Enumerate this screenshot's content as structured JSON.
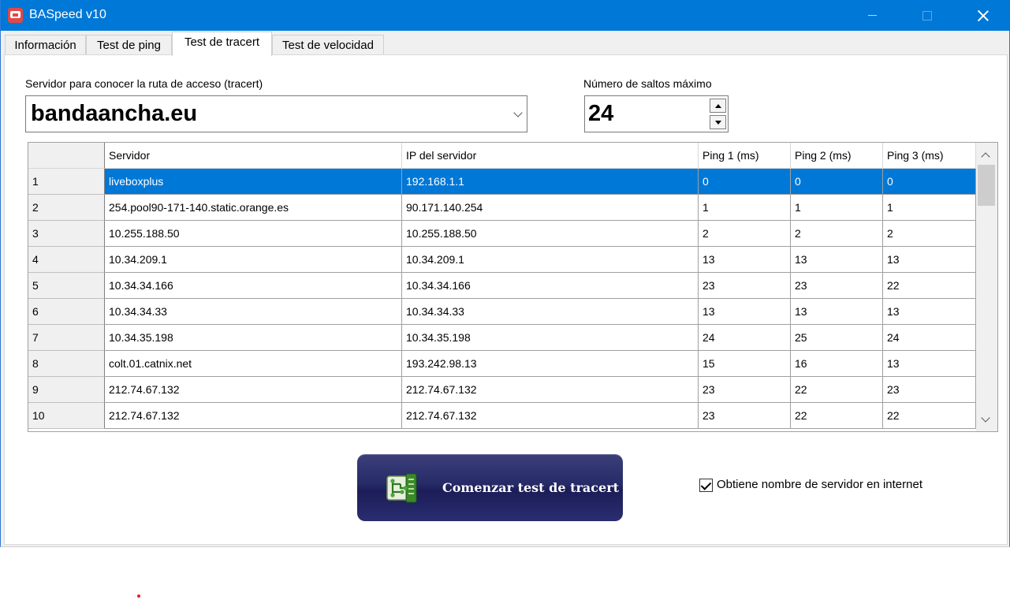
{
  "window": {
    "title": "BASpeed v10"
  },
  "tabs": [
    {
      "label": "Información",
      "active": false
    },
    {
      "label": "Test de ping",
      "active": false
    },
    {
      "label": "Test de tracert",
      "active": true
    },
    {
      "label": "Test de velocidad",
      "active": false
    }
  ],
  "server_field": {
    "label": "Servidor para conocer la ruta de acceso (tracert)",
    "value": "bandaancha.eu"
  },
  "hops_field": {
    "label": "Número de saltos máximo",
    "value": "24"
  },
  "table": {
    "columns": [
      "",
      "Servidor",
      "IP del servidor",
      "Ping 1 (ms)",
      "Ping 2 (ms)",
      "Ping 3 (ms)"
    ],
    "selected_row": 0,
    "rows": [
      [
        "1",
        "liveboxplus",
        "192.168.1.1",
        "0",
        "0",
        "0"
      ],
      [
        "2",
        "254.pool90-171-140.static.orange.es",
        "90.171.140.254",
        "1",
        "1",
        "1"
      ],
      [
        "3",
        "10.255.188.50",
        "10.255.188.50",
        "2",
        "2",
        "2"
      ],
      [
        "4",
        "10.34.209.1",
        "10.34.209.1",
        "13",
        "13",
        "13"
      ],
      [
        "5",
        "10.34.34.166",
        "10.34.34.166",
        "23",
        "23",
        "22"
      ],
      [
        "6",
        "10.34.34.33",
        "10.34.34.33",
        "13",
        "13",
        "13"
      ],
      [
        "7",
        "10.34.35.198",
        "10.34.35.198",
        "24",
        "25",
        "24"
      ],
      [
        "8",
        "colt.01.catnix.net",
        "193.242.98.13",
        "15",
        "16",
        "13"
      ],
      [
        "9",
        "212.74.67.132",
        "212.74.67.132",
        "23",
        "22",
        "23"
      ],
      [
        "10",
        "212.74.67.132",
        "212.74.67.132",
        "23",
        "22",
        "22"
      ]
    ]
  },
  "start_button": {
    "label": "Comenzar test de tracert",
    "icon": "tracert-route-icon"
  },
  "resolve_names": {
    "label": "Obtiene nombre de servidor en internet",
    "checked": true
  },
  "colors": {
    "titlebar": "#0078d7",
    "selection": "#0078d7",
    "button": "#262a66"
  }
}
